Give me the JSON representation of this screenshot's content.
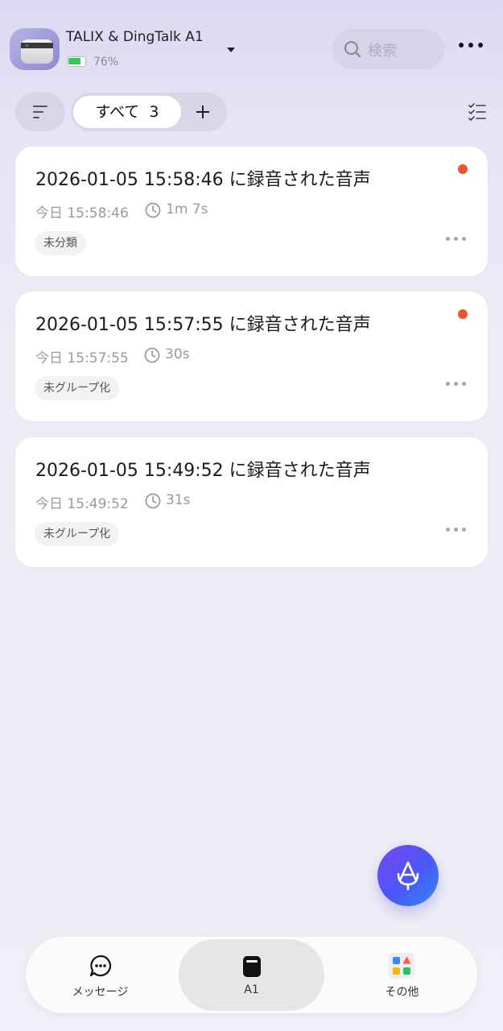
{
  "header": {
    "device_name": "TALIX & DingTalk A1",
    "battery_percent": "76%",
    "battery_level": 0.76,
    "search_placeholder": "検索"
  },
  "filter": {
    "tab_label": "すべて",
    "tab_count": "3"
  },
  "recordings": [
    {
      "title": "2026-01-05 15:58:46 に録音された音声",
      "date": "今日 15:58:46",
      "duration": "1m 7s",
      "tag": "未分類",
      "unread": true
    },
    {
      "title": "2026-01-05 15:57:55 に録音された音声",
      "date": "今日 15:57:55",
      "duration": "30s",
      "tag": "未グループ化",
      "unread": true
    },
    {
      "title": "2026-01-05 15:49:52 に録音された音声",
      "date": "今日 15:49:52",
      "duration": "31s",
      "tag": "未グループ化",
      "unread": false
    }
  ],
  "nav": {
    "messages_label": "メッセージ",
    "a1_label": "A1",
    "other_label": "その他",
    "active": "A1"
  },
  "colors": {
    "unread_dot": "#f0522a",
    "battery_fill": "#39c75c",
    "fab_gradient_start": "#7a48f0",
    "fab_gradient_end": "#2f8bf7"
  },
  "icons": {
    "search": "search-icon",
    "more": "more-horizontal-icon",
    "sort": "sort-icon",
    "add": "plus-icon",
    "checklist": "checklist-icon",
    "clock": "clock-icon",
    "fab": "ai-microphone-icon",
    "messages": "chat-bubble-icon",
    "a1": "device-icon",
    "other": "apps-grid-icon"
  }
}
